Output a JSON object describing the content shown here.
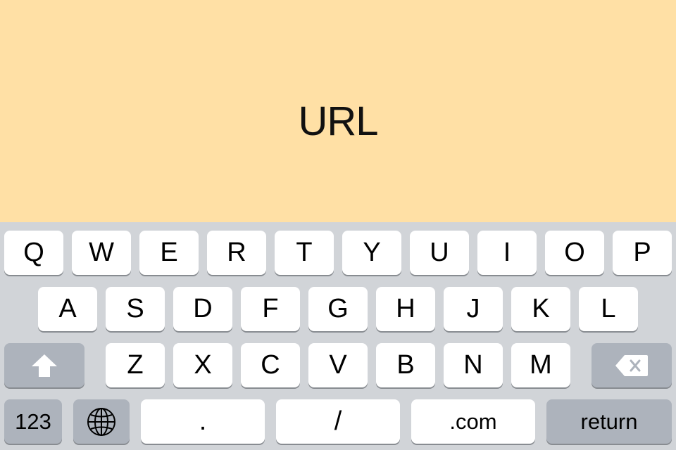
{
  "display": {
    "title": "URL"
  },
  "keyboard": {
    "row1": [
      "Q",
      "W",
      "E",
      "R",
      "T",
      "Y",
      "U",
      "I",
      "O",
      "P"
    ],
    "row2": [
      "A",
      "S",
      "D",
      "F",
      "G",
      "H",
      "J",
      "K",
      "L"
    ],
    "row3": [
      "Z",
      "X",
      "C",
      "V",
      "B",
      "N",
      "M"
    ],
    "bottom": {
      "numbers_label": "123",
      "period_label": ".",
      "slash_label": "/",
      "dotcom_label": ".com",
      "return_label": "return"
    },
    "icons": {
      "shift": "shift-arrow-icon",
      "delete": "backspace-icon",
      "globe": "globe-icon"
    },
    "colors": {
      "background": "#D1D4D8",
      "key": "#FFFFFF",
      "special_key": "#ADB3BC",
      "display_background": "#FFE0A5"
    }
  }
}
